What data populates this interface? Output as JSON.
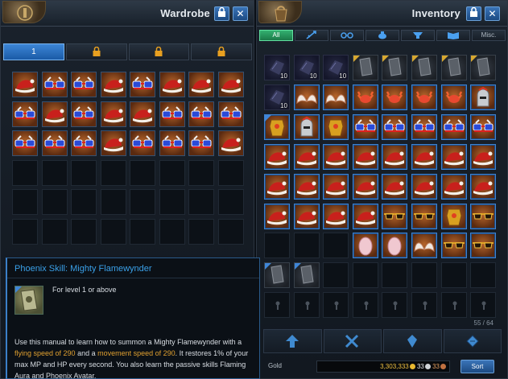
{
  "wardrobe": {
    "title": "Wardrobe",
    "tabs": [
      "1",
      "",
      "",
      ""
    ],
    "rows": [
      [
        "hat",
        "glasses",
        "glasses",
        "hat",
        "glasses",
        "hat",
        "hat",
        "hat"
      ],
      [
        "glasses",
        "hat",
        "glasses",
        "hat",
        "hat",
        "glasses",
        "glasses",
        "glasses"
      ],
      [
        "glasses",
        "glasses",
        "glasses",
        "hat",
        "glasses",
        "glasses",
        "glasses",
        "hat"
      ],
      [
        "",
        "",
        "",
        "",
        "",
        "",
        "",
        ""
      ],
      [
        "",
        "",
        "",
        "",
        "",
        "",
        "",
        ""
      ],
      [
        "",
        "",
        "",
        "",
        "",
        "",
        "",
        ""
      ]
    ]
  },
  "tooltip": {
    "title": "Phoenix Skill: Mighty Flamewynder",
    "level_req": "For level 1 or above",
    "desc_1": "Use this manual to learn how to summon a Mighty Flamewynder with a ",
    "flying_speed": "flying speed of 290",
    "desc_2": " and a ",
    "movement_speed": "movement speed of 290",
    "desc_3": ". It restores 1% of your max MP and HP every second. You also learn the passive skills Flaming Aura and Phoenix Avatar."
  },
  "inventory": {
    "title": "Inventory",
    "tabs": [
      "All",
      "",
      "",
      "",
      "",
      "",
      "Misc."
    ],
    "capacity": "55 / 64",
    "gold_label": "Gold",
    "gold": "3,303,333",
    "silver": "33",
    "copper": "33",
    "sort_label": "Sort",
    "rows": [
      [
        "stack",
        "stack",
        "stack",
        "book",
        "book",
        "book",
        "book",
        "book"
      ],
      [
        "stack",
        "wings",
        "wings",
        "crab",
        "crab",
        "crab",
        "crab",
        "helm"
      ],
      [
        "armor",
        "helm",
        "armor",
        "glasses",
        "glasses",
        "glasses",
        "glasses",
        "glasses"
      ],
      [
        "hat",
        "hat",
        "hat",
        "hat",
        "hat",
        "hat",
        "hat",
        "hat"
      ],
      [
        "hat",
        "hat",
        "hat",
        "hat",
        "hat",
        "hat",
        "hat",
        "hat"
      ],
      [
        "hat",
        "hat",
        "hat",
        "hat",
        "glasses-gold",
        "glasses-gold",
        "armor",
        "glasses-gold"
      ],
      [
        "",
        "",
        "",
        "egg",
        "egg",
        "wings",
        "glasses-gold",
        "glasses-gold"
      ],
      [
        "book",
        "book",
        "",
        "",
        "",
        "",
        "",
        ""
      ],
      [
        "locked",
        "locked",
        "locked",
        "locked",
        "locked",
        "locked",
        "locked",
        "locked"
      ]
    ],
    "stack_count": "10"
  },
  "colors": {
    "accent_blue": "#3b7fc8",
    "highlight_orange": "#e0a030",
    "tab_green": "#33b070"
  }
}
